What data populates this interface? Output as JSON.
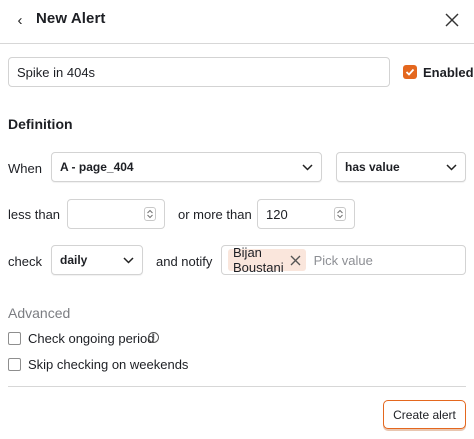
{
  "header": {
    "title": "New Alert"
  },
  "alert": {
    "name": "Spike in 404s",
    "enabled_label": "Enabled",
    "enabled_checked": true
  },
  "definition": {
    "title": "Definition",
    "when_label": "When",
    "metric": "A - page_404",
    "condition": "has value",
    "less_than_label": "less than",
    "less_than_value": "",
    "more_than_label": "or more than",
    "more_than_value": "120",
    "check_label": "check",
    "frequency": "daily",
    "notify_label": "and notify",
    "recipients": [
      "Bijan Boustani"
    ],
    "pick_placeholder": "Pick value"
  },
  "advanced": {
    "title": "Advanced",
    "options": [
      {
        "label": "Check ongoing period",
        "checked": false
      },
      {
        "label": "Skip checking on weekends",
        "checked": false
      }
    ]
  },
  "footer": {
    "create_label": "Create alert"
  },
  "colors": {
    "accent": "#e4671e",
    "chip_bg": "#fae6dc"
  }
}
